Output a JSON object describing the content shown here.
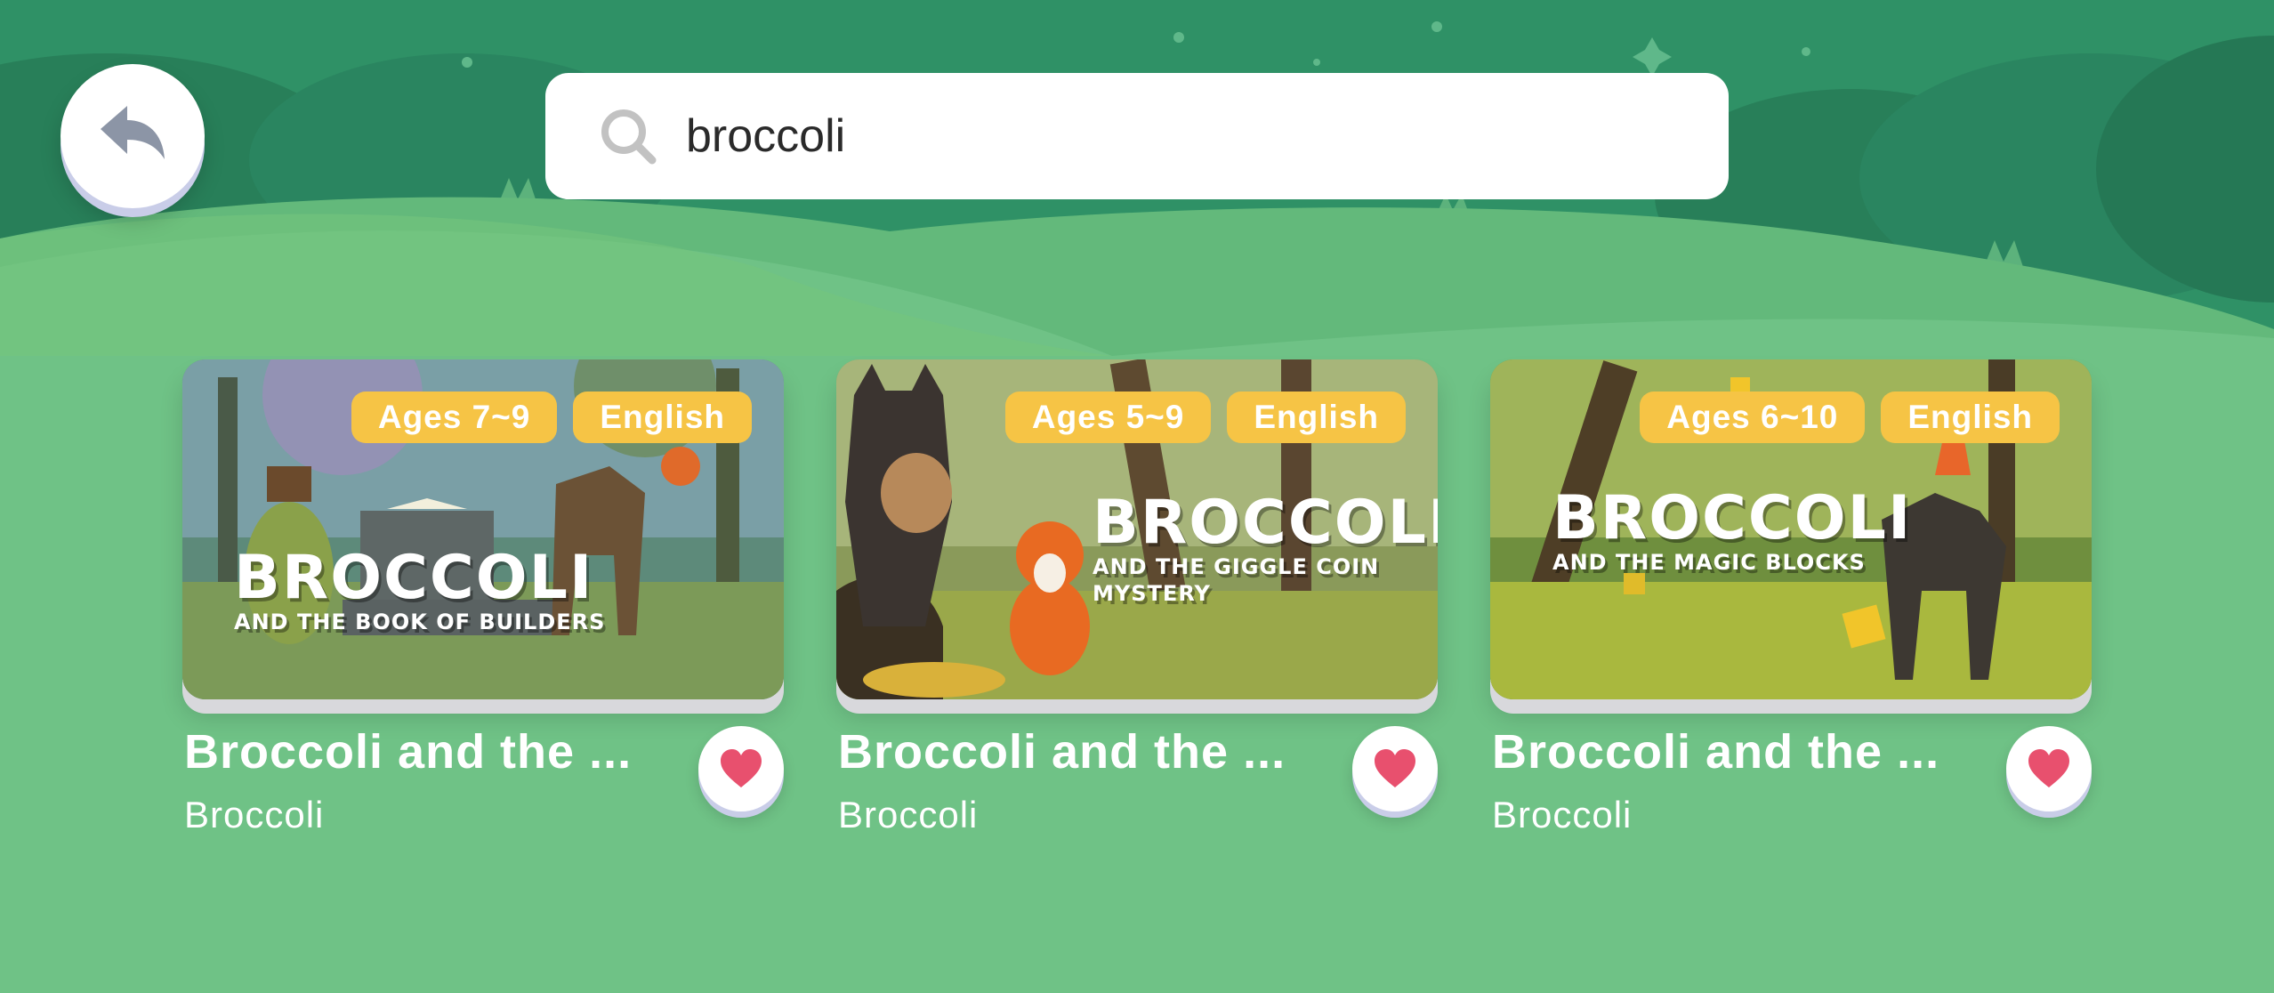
{
  "search": {
    "query": "broccoli"
  },
  "colors": {
    "badge": "#f6c445",
    "heart": "#e8506e",
    "sky": "#2f9166",
    "hill": "#6fc286"
  },
  "icons": {
    "back": "back-arrow-icon",
    "search": "search-icon",
    "favorite": "heart-icon"
  },
  "books": [
    {
      "ages": "Ages 7~9",
      "language": "English",
      "cover_title": "BROCCOLI",
      "cover_subtitle": "AND THE BOOK OF BUILDERS",
      "title": "Broccoli and the ...",
      "author": "Broccoli"
    },
    {
      "ages": "Ages 5~9",
      "language": "English",
      "cover_title": "BROCCOLI",
      "cover_subtitle": "AND THE GIGGLE COIN MYSTERY",
      "title": "Broccoli and the ...",
      "author": "Broccoli"
    },
    {
      "ages": "Ages 6~10",
      "language": "English",
      "cover_title": "BROCCOLI",
      "cover_subtitle": "AND THE MAGIC BLOCKS",
      "title": "Broccoli and the ...",
      "author": "Broccoli"
    }
  ]
}
